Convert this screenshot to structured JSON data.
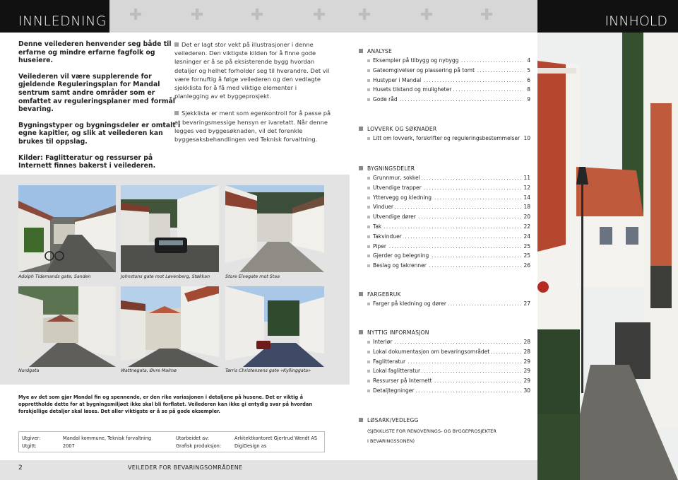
{
  "header": {
    "left_title": "INNLEDNING",
    "right_title": "INNHOLD"
  },
  "intro": {
    "p1": "Denne veilederen henvender seg både til erfarne og mindre erfarne fagfolk og huseiere.",
    "p2": "Veilederen vil være supplerende for gjeldende Reguleringsplan for Mandal sentrum samt andre områder som er omfattet av reguleringsplaner med formål bevaring.",
    "p3": "Bygningstyper og bygningsdeler er omtalt i egne kapitler, og slik at veilederen kan brukes til oppslag.",
    "p4": "Kilder: Faglitteratur og ressurser på Internett finnes bakerst i veilederen."
  },
  "middle": {
    "p1": "Det er lagt stor vekt på illustrasjoner i denne veilederen. Den viktigste kilden for å finne gode løsninger er å se på eksisterende bygg hvordan detaljer og helhet forholder seg til hverandre. Det vil være fornuftig å følge veilederen og den vedlagte sjekklista for å få med viktige elementer i planlegging av et byggeprosjekt.",
    "p2": "Sjekklista er ment som egenkontroll for å passe på at bevaringsmessige hensyn er ivaretatt. Når denne legges ved byggesøknaden, vil det forenkle byggesaksbehandlingen ved Teknisk forvaltning."
  },
  "photos": {
    "captions": [
      "Adolph Tidemands gate, Sanden",
      "Johnstons gate mot Løvenberg, Støkkan",
      "Store Elvegate mot Staa",
      "Nordgata",
      "Wattnegata, Øvre Malmø",
      "Tørris Christensens gate «Kyllinggata»"
    ]
  },
  "note": "Mye av det som gjør Mandal fin og spennende, er den rike variasjonen i detaljene på husene. Det er viktig å opprettholde dette for at bygningsmiljøet ikke skal bli forflatet. Veilederen kan ikke gi entydig svar på hvordan forskjellige detaljer skal løses. Det aller viktigste er å se på gode eksempler.",
  "credits": {
    "utgiver_label": "Utgiver:",
    "utgiver_value": "Mandal kommune, Teknisk forvaltning",
    "utgitt_label": "Utgitt:",
    "utgitt_value": "2007",
    "utarbeidet_label": "Utarbeidet av:",
    "utarbeidet_value": "Arkitektkontoret Gjertrud Wendt AS",
    "grafisk_label": "Grafisk produksjon:",
    "grafisk_value": "DigiDesign as"
  },
  "footer": {
    "page_number": "2",
    "title": "VEILEDER FOR BEVARINGSOMRÅDENE"
  },
  "toc": {
    "sections": [
      {
        "title": "ANALYSE",
        "items": [
          {
            "label": "Eksempler på tilbygg og nybygg",
            "page": "4"
          },
          {
            "label": "Gateomgivelser og plassering på tomt",
            "page": "5"
          },
          {
            "label": "Hustyper i Mandal",
            "page": "6"
          },
          {
            "label": "Husets tilstand og muligheter",
            "page": "8"
          },
          {
            "label": "Gode råd",
            "page": "9"
          }
        ]
      },
      {
        "title": "LOVVERK OG SØKNADER",
        "items": [
          {
            "label": "Litt om lovverk, forskrifter og reguleringsbestemmelser",
            "page": "10"
          }
        ]
      },
      {
        "title": "BYGNINGSDELER",
        "items": [
          {
            "label": "Grunnmur, sokkel",
            "page": "11"
          },
          {
            "label": "Utvendige trapper",
            "page": "12"
          },
          {
            "label": "Yttervegg og kledning",
            "page": "14"
          },
          {
            "label": "Vinduer",
            "page": "18"
          },
          {
            "label": "Utvendige dører",
            "page": "20"
          },
          {
            "label": "Tak",
            "page": "22"
          },
          {
            "label": "Takvinduer",
            "page": "24"
          },
          {
            "label": "Piper",
            "page": "25"
          },
          {
            "label": "Gjerder og belegning",
            "page": "25"
          },
          {
            "label": "Beslag og takrenner",
            "page": "26"
          }
        ]
      },
      {
        "title": "FARGEBRUK",
        "items": [
          {
            "label": "Farger på kledning og dører",
            "page": "27"
          }
        ]
      },
      {
        "title": "NYTTIG INFORMASJON",
        "items": [
          {
            "label": "Interiør",
            "page": "28"
          },
          {
            "label": "Lokal dokumentasjon om bevaringsområdet",
            "page": "28"
          },
          {
            "label": "Faglitteratur",
            "page": "29"
          },
          {
            "label": "Lokal faglitteratur",
            "page": "29"
          },
          {
            "label": "Ressurser på Internett",
            "page": "29"
          },
          {
            "label": "Detaljtegninger",
            "page": "30"
          }
        ]
      },
      {
        "title": "LØSARK/VEDLEGG",
        "subtitle1": "(SJEKKLISTE FOR RENOVERINGS- OG BYGGEPROSJEKTER",
        "subtitle2": "I BEVARINGSSONEN)"
      }
    ]
  }
}
